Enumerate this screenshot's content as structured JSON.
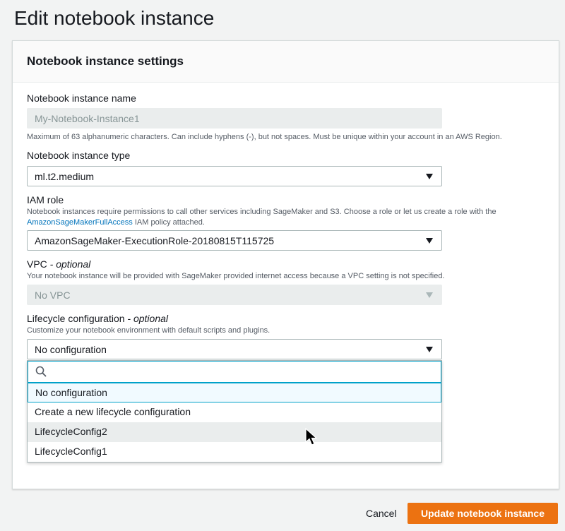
{
  "page": {
    "title": "Edit notebook instance"
  },
  "panel": {
    "title": "Notebook instance settings"
  },
  "name_field": {
    "label": "Notebook instance name",
    "value": "My-Notebook-Instance1",
    "hint": "Maximum of 63 alphanumeric characters. Can include hyphens (-), but not spaces. Must be unique within your account in an AWS Region."
  },
  "type_field": {
    "label": "Notebook instance type",
    "value": "ml.t2.medium"
  },
  "iam_field": {
    "label": "IAM role",
    "hint_prefix": "Notebook instances require permissions to call other services including SageMaker and S3. Choose a role or let us create a role with the ",
    "hint_link": "AmazonSageMakerFullAccess",
    "hint_suffix": " IAM policy attached.",
    "value": "AmazonSageMaker-ExecutionRole-20180815T115725"
  },
  "vpc_field": {
    "label": "VPC",
    "label_optional": " - optional",
    "hint": "Your notebook instance will be provided with SageMaker provided internet access because a VPC setting is not specified.",
    "value": "No VPC"
  },
  "lifecycle_field": {
    "label": "Lifecycle configuration",
    "label_optional": " - optional",
    "hint": "Customize your notebook environment with default scripts and plugins.",
    "value": "No configuration",
    "search_placeholder": "",
    "options": [
      {
        "label": "No configuration",
        "state": "selected"
      },
      {
        "label": "Create a new lifecycle configuration",
        "state": "normal"
      },
      {
        "label": "LifecycleConfig2",
        "state": "hover"
      },
      {
        "label": "LifecycleConfig1",
        "state": "normal"
      }
    ]
  },
  "footer": {
    "cancel_label": "Cancel",
    "submit_label": "Update notebook instance"
  },
  "colors": {
    "accent": "#00a1c9",
    "primary": "#ec7211",
    "link": "#0073bb"
  }
}
